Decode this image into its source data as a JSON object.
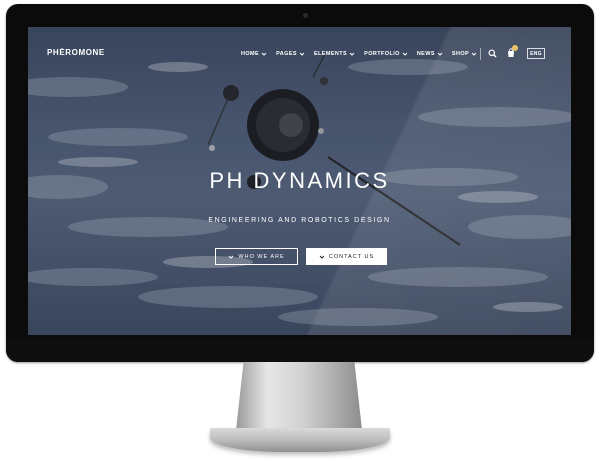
{
  "header": {
    "logo": "PHĖROMONE",
    "nav": [
      "HOME",
      "PAGES",
      "ELEMENTS",
      "PORTFOLIO",
      "NEWS",
      "SHOP"
    ],
    "language": "ENG"
  },
  "hero": {
    "title": "PH DYNAMICS",
    "subtitle": "ENGINEERING AND ROBOTICS DESIGN",
    "buttons": {
      "who_label": "WHO WE ARE",
      "contact_label": "CONTACT US"
    }
  },
  "icons": [
    "search-icon",
    "cart-icon",
    "chevron-down-icon"
  ],
  "colors": {
    "bezel": "#0b0b0b",
    "sky": "#51607a",
    "accent": "#ffffff"
  }
}
